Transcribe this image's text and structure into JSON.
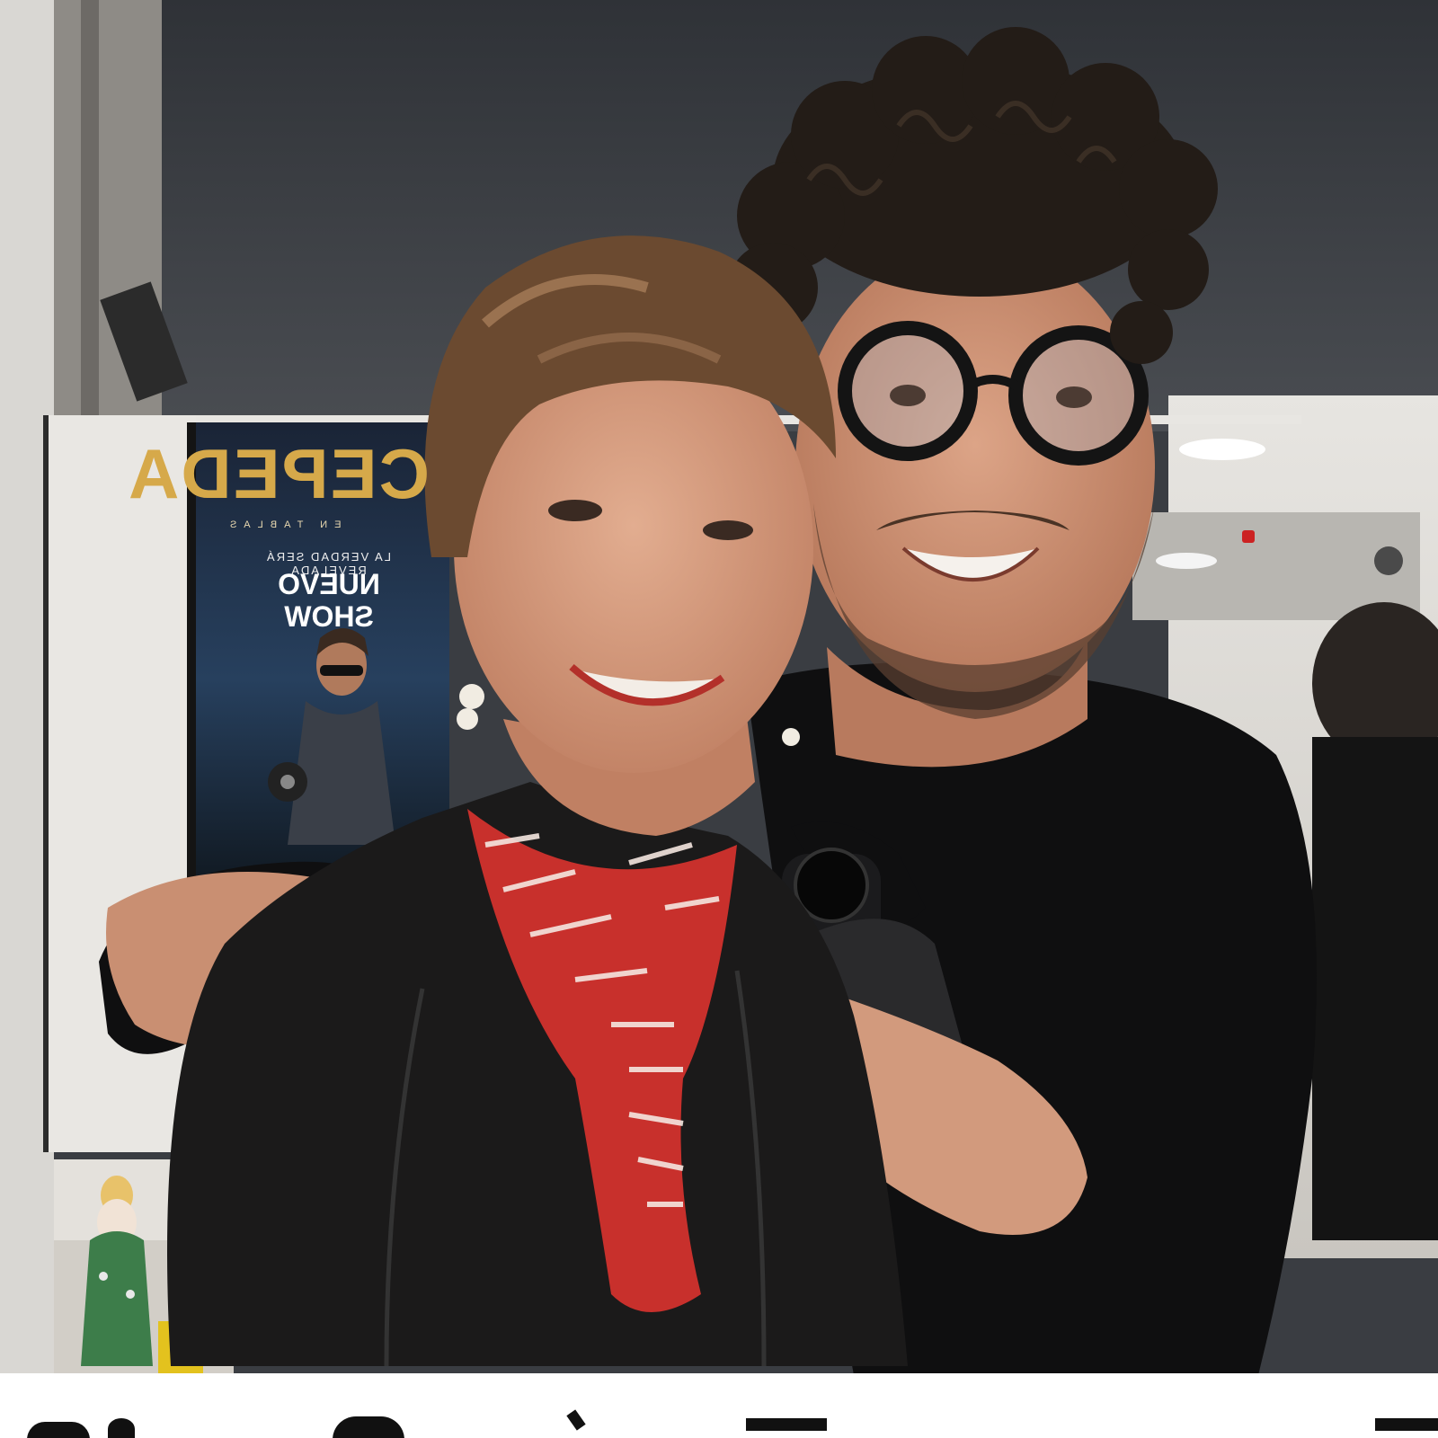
{
  "image": {
    "kind": "photograph",
    "scene": "two people embracing and smiling in a dressing room mirror"
  },
  "poster": {
    "title": "CEPEDA",
    "subtitle": "EN TABLAS",
    "tagline": "LA VERDAD SERÁ REVELADA",
    "show_line1": "NUEVO",
    "show_line2": "SHOW"
  },
  "colors": {
    "wall": "#c9c6c2",
    "ceiling": "#3b3e43",
    "poster_bg": "#1c2637",
    "poster_gold": "#d6a94a",
    "jacket": "#1b1a1a",
    "sweater": "#0f0f10",
    "scarf_red": "#c8302c",
    "hair_dark": "#231c17",
    "hair_brown": "#6b4a30",
    "skin": "#d9a184"
  }
}
